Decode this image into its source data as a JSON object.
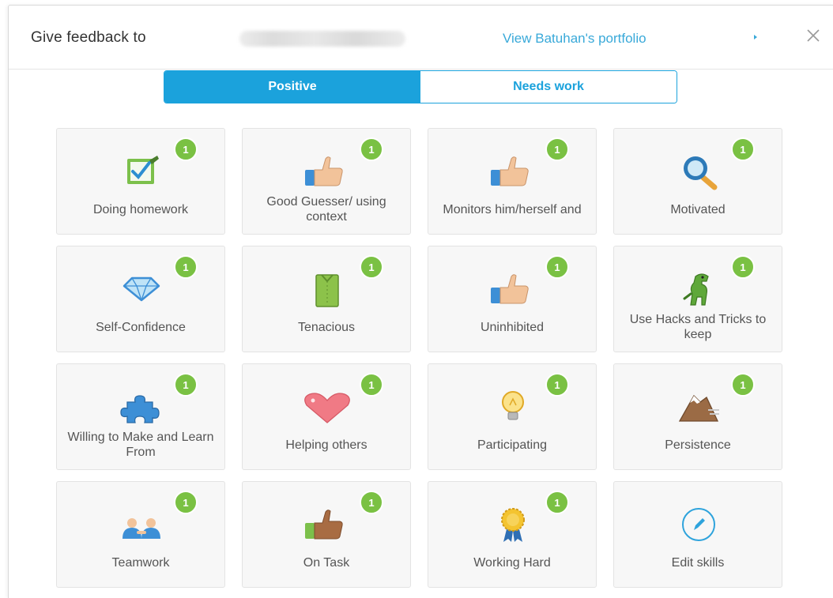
{
  "header": {
    "title": "Give feedback to",
    "portfolio_link": "View Batuhan's portfolio"
  },
  "tabs": [
    {
      "label": "Positive",
      "active": true
    },
    {
      "label": "Needs work",
      "active": false
    }
  ],
  "skills": [
    {
      "label": "Doing homework",
      "count": "1",
      "icon": "checkbox-icon"
    },
    {
      "label": "Good Guesser/ using context",
      "count": "1",
      "icon": "thumbs-up-icon"
    },
    {
      "label": "Monitors him/herself and",
      "count": "1",
      "icon": "thumbs-up-icon"
    },
    {
      "label": "Motivated",
      "count": "1",
      "icon": "magnifier-icon"
    },
    {
      "label": "Self-Confidence",
      "count": "1",
      "icon": "diamond-icon"
    },
    {
      "label": "Tenacious",
      "count": "1",
      "icon": "shirt-icon"
    },
    {
      "label": "Uninhibited",
      "count": "1",
      "icon": "thumbs-up-icon"
    },
    {
      "label": "Use Hacks and Tricks to keep",
      "count": "1",
      "icon": "dinosaur-icon"
    },
    {
      "label": "Willing to Make and Learn From",
      "count": "1",
      "icon": "puzzle-icon"
    },
    {
      "label": "Helping others",
      "count": "1",
      "icon": "heart-icon"
    },
    {
      "label": "Participating",
      "count": "1",
      "icon": "lightbulb-icon"
    },
    {
      "label": "Persistence",
      "count": "1",
      "icon": "mountain-icon"
    },
    {
      "label": "Teamwork",
      "count": "1",
      "icon": "people-icon"
    },
    {
      "label": "On Task",
      "count": "1",
      "icon": "thumbs-up-dark-icon"
    },
    {
      "label": "Working Hard",
      "count": "1",
      "icon": "ribbon-medal-icon"
    },
    {
      "label": "Edit skills",
      "count": "",
      "icon": "pencil-icon"
    }
  ],
  "colors": {
    "accent": "#1ba2dc",
    "badge": "#7ac143",
    "link": "#39a9d9"
  }
}
